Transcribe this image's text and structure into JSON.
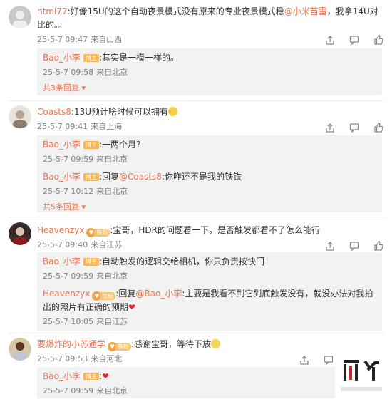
{
  "comments": [
    {
      "user": "html77",
      "text_a": ":好像15U的这个自动夜景模式没有原来的专业夜景模式稳",
      "mention": "@小米苗雷",
      "text_b": "，我拿14U对比的。。",
      "time": "25-5-7 09:47",
      "location": "来自山西",
      "replies": [
        {
          "user": "Bao_小李",
          "badge": "博主",
          "text": ":其实是一模一样的。",
          "time": "25-5-7 09:58",
          "location": "来自北京"
        }
      ],
      "more": "共3条回复"
    },
    {
      "user": "Coasts8",
      "text_a": ":13U预计啥时候可以拥有",
      "time": "25-5-7 09:41",
      "location": "来自上海",
      "replies": [
        {
          "user": "Bao_小李",
          "badge": "博主",
          "text": ":一两个月?",
          "time": "25-5-7 09:59",
          "location": "来自北京"
        },
        {
          "user": "Bao_小李",
          "badge": "博主",
          "text_a": ":回复",
          "mention": "@Coasts8",
          "text_b": ":你咋还不是我的铁铁",
          "time": "25-5-7 10:12",
          "location": "来自北京"
        }
      ],
      "more": "共5条回复"
    },
    {
      "user": "Heavenzyx",
      "vbadge": "铁粉",
      "text_a": ":宝哥，HDR的问题看一下，是否触发都看不了怎么能行",
      "time": "25-5-7 09:40",
      "location": "来自江苏",
      "replies": [
        {
          "user": "Bao_小李",
          "badge": "博主",
          "text": ":自动触发的逻辑交给相机，你只负责按快门",
          "time": "25-5-7 09:59",
          "location": "来自北京"
        },
        {
          "user": "Heavenzyx",
          "vbadge": "铁粉",
          "text_a": ":回复",
          "mention": "@Bao_小李",
          "text_b": ":主要是我看不到它到底触发没有，就没办法对我拍出的照片有正确的预期",
          "time": "25-5-7 10:05",
          "location": "来自江苏"
        }
      ]
    },
    {
      "user": "要爆炸的小苏通学",
      "vbadge": "铁粉",
      "text_a": ":感谢宝哥，等待下放",
      "time": "25-5-7 09:53",
      "location": "来自河北",
      "replies": [
        {
          "user": "Bao_小李",
          "badge": "博主",
          "text": ":",
          "time": "25-5-7 09:59",
          "location": "来自北京"
        }
      ]
    }
  ],
  "icons": [
    "share-icon",
    "comment-icon",
    "like-icon",
    "heart-emoji",
    "smile-emoji",
    "avatar"
  ],
  "colors": {
    "link": "#eb7350",
    "meta": "#808080",
    "reply_bg": "#f2f2f2"
  }
}
